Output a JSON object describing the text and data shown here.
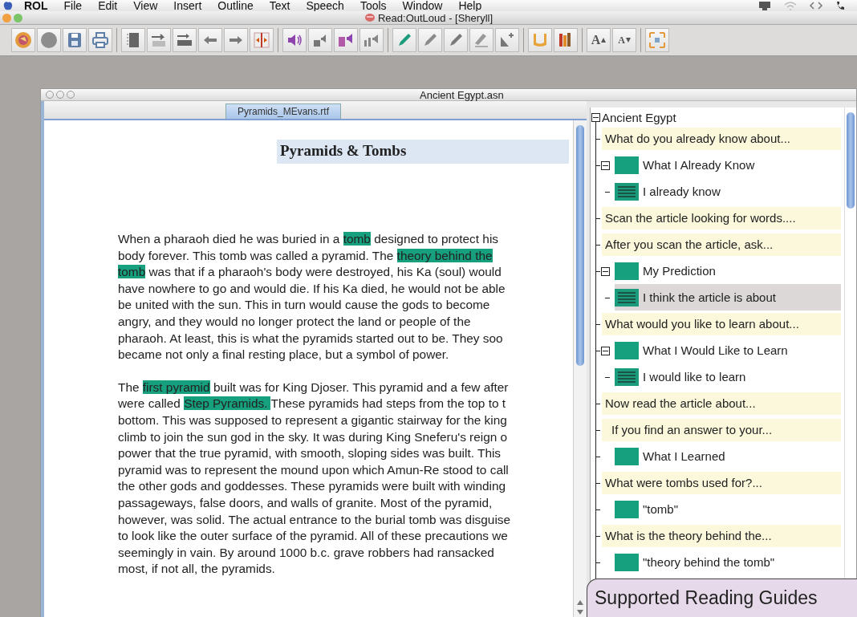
{
  "menu_bar": {
    "items": [
      {
        "label": "ROL",
        "kind": "app"
      },
      {
        "label": "File",
        "kind": "menu"
      },
      {
        "label": "Edit",
        "kind": "menu"
      },
      {
        "label": "View",
        "kind": "menu"
      },
      {
        "label": "Insert",
        "kind": "menu"
      },
      {
        "label": "Outline",
        "kind": "menu"
      },
      {
        "label": "Text",
        "kind": "menu"
      },
      {
        "label": "Speech",
        "kind": "menu"
      },
      {
        "label": "Tools",
        "kind": "menu"
      },
      {
        "label": "Window",
        "kind": "menu"
      },
      {
        "label": "Help",
        "kind": "menu"
      }
    ]
  },
  "window": {
    "title": "Read:OutLoud - [Sheryll]"
  },
  "toolbar": {
    "font_buttons": [
      {
        "label": "A",
        "kind": "up"
      },
      {
        "label": "A",
        "kind": "down"
      }
    ]
  },
  "document": {
    "title": "Ancient Egypt.asn",
    "tabs": [
      {
        "label": "Pyramids_MEvans.rtf",
        "selected": true
      }
    ],
    "heading": "Pyramids & Tombs",
    "paragraphs": [
      {
        "lines": [
          [
            {
              "text": "When a pharaoh died he was buried in a ",
              "highlighted": false
            },
            {
              "text": "tomb",
              "highlighted": true
            },
            {
              "text": " designed to protect his",
              "highlighted": false
            }
          ],
          [
            {
              "text": "body forever. This tomb was called a pyramid. The ",
              "highlighted": false
            },
            {
              "text": "theory behind the",
              "highlighted": true
            }
          ],
          [
            {
              "text": "tomb",
              "highlighted": true
            },
            {
              "text": " was that if a pharaoh's body were destroyed, his Ka (soul) would",
              "highlighted": false
            }
          ],
          [
            {
              "text": "have nowhere to go and would die. If his Ka died, he would not be able",
              "highlighted": false
            }
          ],
          [
            {
              "text": "be united with the sun. This in turn would cause the gods to become",
              "highlighted": false
            }
          ],
          [
            {
              "text": "angry, and they would no longer protect the land or people of the",
              "highlighted": false
            }
          ],
          [
            {
              "text": "pharaoh. At least, this is what the pyramids started out to be. They soo",
              "highlighted": false
            }
          ],
          [
            {
              "text": "became not only a final resting place, but a symbol of power.",
              "highlighted": false
            }
          ]
        ]
      },
      {
        "lines": [
          [
            {
              "text": "The ",
              "highlighted": false
            },
            {
              "text": "first pyramid",
              "highlighted": true
            },
            {
              "text": " built was for King Djoser. This pyramid and a few after",
              "highlighted": false
            }
          ],
          [
            {
              "text": "were called ",
              "highlighted": false
            },
            {
              "text": "Step Pyramids. ",
              "highlighted": true
            },
            {
              "text": " These pyramids had steps from the top to t",
              "highlighted": false
            }
          ],
          [
            {
              "text": "bottom. This was supposed to represent a gigantic stairway for the king",
              "highlighted": false
            }
          ],
          [
            {
              "text": "climb to join the sun god in the sky. It was during King Sneferu's reign o",
              "highlighted": false
            }
          ],
          [
            {
              "text": "power that the true pyramid, with smooth, sloping sides was built. This",
              "highlighted": false
            }
          ],
          [
            {
              "text": "pyramid was to represent the mound upon which Amun-Re stood to call",
              "highlighted": false
            }
          ],
          [
            {
              "text": "the other gods and goddesses. These pyramids were built with winding",
              "highlighted": false
            }
          ],
          [
            {
              "text": "passageways, false doors, and walls of granite. Most of the pyramid,",
              "highlighted": false
            }
          ],
          [
            {
              "text": "however, was solid. The actual entrance to the burial tomb was disguise",
              "highlighted": false
            }
          ],
          [
            {
              "text": "to look like the outer surface of the pyramid. All of these precautions we",
              "highlighted": false
            }
          ],
          [
            {
              "text": "seemingly in vain. By around 1000 b.c. grave robbers had ransacked",
              "highlighted": false
            }
          ],
          [
            {
              "text": "most, if not all, the pyramids.",
              "highlighted": false
            }
          ]
        ]
      }
    ]
  },
  "outline": {
    "root": {
      "label": "Ancient Egypt",
      "kind": "root",
      "selected": false,
      "expanded": true,
      "children": [
        {
          "label": "What do you already know about...",
          "kind": "prompt",
          "selected": false
        },
        {
          "label": "What I Already Know",
          "kind": "note",
          "selected": false,
          "expanded": true,
          "children": [
            {
              "label": "I already know",
              "kind": "text",
              "selected": false
            }
          ]
        },
        {
          "label": "Scan the article looking for words....",
          "kind": "prompt",
          "selected": false
        },
        {
          "label": "After you scan the article, ask...",
          "kind": "prompt",
          "selected": false
        },
        {
          "label": "My Prediction",
          "kind": "note",
          "selected": false,
          "expanded": true,
          "children": [
            {
              "label": "I think the article is about",
              "kind": "text",
              "selected": true
            }
          ]
        },
        {
          "label": "What would you like to learn about...",
          "kind": "prompt",
          "selected": false
        },
        {
          "label": "What I Would Like to Learn",
          "kind": "note",
          "selected": false,
          "expanded": true,
          "children": [
            {
              "label": "I would like to learn",
              "kind": "text",
              "selected": false
            }
          ]
        },
        {
          "label": "Now read the article about...",
          "kind": "prompt",
          "selected": false
        },
        {
          "label": "If you find an answer to your...",
          "kind": "subprompt",
          "selected": false
        },
        {
          "label": "What I Learned",
          "kind": "note",
          "selected": false
        },
        {
          "label": "What were tombs used for?...",
          "kind": "prompt",
          "selected": false
        },
        {
          "label": "\"tomb\"",
          "kind": "note",
          "selected": false
        },
        {
          "label": "What is the theory behind the...",
          "kind": "prompt",
          "selected": false
        },
        {
          "label": "\"theory behind the tomb\"",
          "kind": "note",
          "selected": false
        }
      ]
    }
  },
  "caption": "Supported Reading Guides"
}
